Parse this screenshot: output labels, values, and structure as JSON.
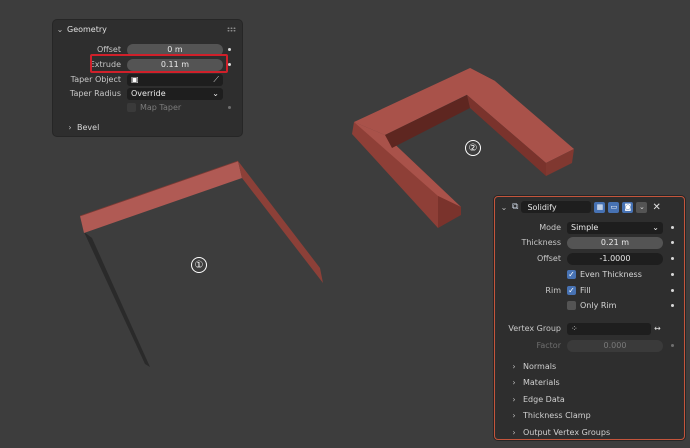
{
  "geometry_panel": {
    "title": "Geometry",
    "offset": {
      "label": "Offset",
      "value": "0 m"
    },
    "extrude": {
      "label": "Extrude",
      "value": "0.11 m"
    },
    "taper_object": {
      "label": "Taper Object"
    },
    "taper_radius": {
      "label": "Taper Radius",
      "value": "Override"
    },
    "map_taper": {
      "label": "Map Taper"
    },
    "bevel": {
      "label": "Bevel"
    }
  },
  "markers": {
    "one": "①",
    "two": "②"
  },
  "solidify": {
    "name": "Solidify",
    "mode": {
      "label": "Mode",
      "value": "Simple"
    },
    "thickness": {
      "label": "Thickness",
      "value": "0.21 m"
    },
    "offset": {
      "label": "Offset",
      "value": "-1.0000"
    },
    "even_thickness": {
      "label": "Even Thickness",
      "checked": true
    },
    "rim": {
      "label": "Rim"
    },
    "fill": {
      "label": "Fill",
      "checked": true
    },
    "only_rim": {
      "label": "Only Rim",
      "checked": false
    },
    "vertex_group": {
      "label": "Vertex Group"
    },
    "factor": {
      "label": "Factor",
      "value": "0.000"
    },
    "subpanels": [
      "Normals",
      "Materials",
      "Edge Data",
      "Thickness Clamp",
      "Output Vertex Groups"
    ]
  },
  "colors": {
    "background": "#3d3d3d",
    "panel": "#2e2e2e",
    "accent_blue": "#4772b3",
    "highlight_red": "#d0202a",
    "object_face": "#a8504a"
  }
}
